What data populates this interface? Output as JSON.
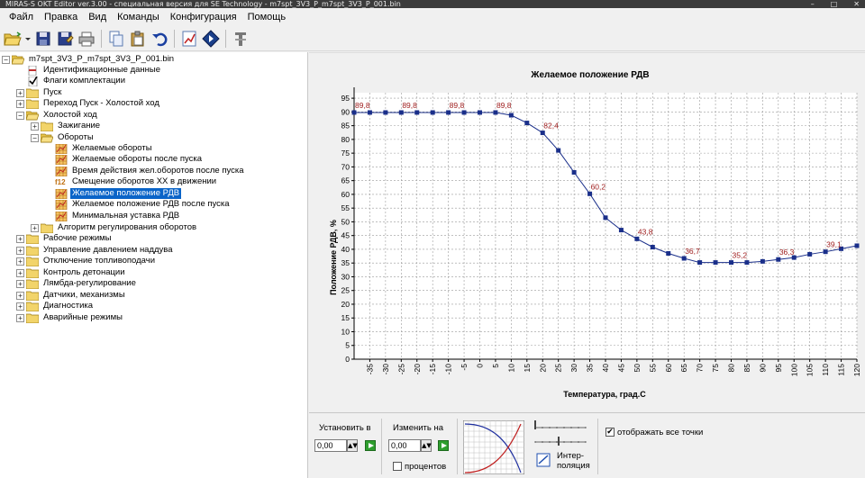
{
  "window": {
    "title": "MIRAS-S OKT Editor ver.3.00 - специальная версия для SE Technology - m7spt_3V3_P_m7spt_3V3_P_001.bin",
    "minimize_glyph": "–",
    "maximize_glyph": "□",
    "close_glyph": "✕"
  },
  "menu": {
    "items": [
      "Файл",
      "Правка",
      "Вид",
      "Команды",
      "Конфигурация",
      "Помощь"
    ]
  },
  "toolbar": {
    "icons": [
      "open-folder-icon",
      "save-icon",
      "save-as-icon",
      "print-icon",
      "copy-icon",
      "paste-icon",
      "undo-icon",
      "chart-icon",
      "diamond-nav-icon",
      "tools-icon"
    ]
  },
  "tree": {
    "root": "m7spt_3V3_P_m7spt_3V3_P_001.bin",
    "n_ident": "Идентификационные данные",
    "n_flags": "Флаги комплектации",
    "n_pusk": "Пуск",
    "n_perehod": "Переход Пуск - Холостой ход",
    "n_hh": "Холостой ход",
    "n_zazh": "Зажигание",
    "n_obor": "Обороты",
    "n_o1": "Желаемые обороты",
    "n_o2": "Желаемые обороты после пуска",
    "n_o3": "Время действия жел.оборотов после пуска",
    "n_o4": "Смещение оборотов ХХ в движении",
    "n_o4_badge": "f12",
    "n_o5": "Желаемое положение РДВ",
    "n_o6": "Желаемое положение РДВ после пуска",
    "n_o7": "Минимальная уставка РДВ",
    "n_alg": "Алгоритм регулирования оборотов",
    "n_rab": "Рабочие режимы",
    "n_upr": "Управление давлением наддува",
    "n_otkl": "Отключение топливоподачи",
    "n_kontr": "Контроль детонации",
    "n_lyam": "Лямбда-регулирование",
    "n_dat": "Датчики, механизмы",
    "n_diag": "Диагностика",
    "n_avar": "Аварийные режимы",
    "expand_glyph": "+",
    "collapse_glyph": "−",
    "checkmark": "✔"
  },
  "chart_data": {
    "type": "line",
    "title": "Желаемое положение РДВ",
    "xlabel": "Температура, град.С",
    "ylabel": "Положение РДВ, %",
    "x": [
      -40,
      -35,
      -30,
      -25,
      -20,
      -15,
      -10,
      -5,
      0,
      5,
      10,
      15,
      20,
      25,
      30,
      35,
      40,
      45,
      50,
      55,
      60,
      65,
      70,
      75,
      80,
      85,
      90,
      95,
      100,
      105,
      110,
      115,
      120
    ],
    "series": [
      {
        "values": [
          89.8,
          89.8,
          89.8,
          89.8,
          89.8,
          89.8,
          89.8,
          89.8,
          89.8,
          89.8,
          88.8,
          86.0,
          82.4,
          76.0,
          68.0,
          60.2,
          51.5,
          47.0,
          43.8,
          40.8,
          38.5,
          36.7,
          35.2,
          35.2,
          35.2,
          35.2,
          35.6,
          36.3,
          37.0,
          38.2,
          39.1,
          40.2,
          41.3
        ],
        "color": "#1a2f8a"
      }
    ],
    "point_labels": [
      {
        "x": -40,
        "y": 89.8,
        "text": "89,8"
      },
      {
        "x": -25,
        "y": 89.8,
        "text": "89,8"
      },
      {
        "x": -10,
        "y": 89.8,
        "text": "89,8"
      },
      {
        "x": 5,
        "y": 89.8,
        "text": "89,8"
      },
      {
        "x": 20,
        "y": 82.4,
        "text": "82,4"
      },
      {
        "x": 35,
        "y": 60.2,
        "text": "60,2"
      },
      {
        "x": 50,
        "y": 43.8,
        "text": "43,8"
      },
      {
        "x": 65,
        "y": 36.7,
        "text": "36,7"
      },
      {
        "x": 80,
        "y": 35.2,
        "text": "35,2"
      },
      {
        "x": 95,
        "y": 36.3,
        "text": "36,3"
      },
      {
        "x": 110,
        "y": 39.1,
        "text": "39,1"
      }
    ],
    "xticks": [
      -35,
      -30,
      -25,
      -20,
      -15,
      -10,
      -5,
      0,
      5,
      10,
      15,
      20,
      25,
      30,
      35,
      40,
      45,
      50,
      55,
      60,
      65,
      70,
      75,
      80,
      85,
      90,
      95,
      100,
      105,
      110,
      115,
      120
    ],
    "yticks": [
      0,
      5,
      10,
      15,
      20,
      25,
      30,
      35,
      40,
      45,
      50,
      55,
      60,
      65,
      70,
      75,
      80,
      85,
      90,
      95
    ],
    "xlim": [
      -40,
      120
    ],
    "ylim": [
      0,
      97
    ],
    "grid": true,
    "label_color": "#a02020"
  },
  "controls": {
    "set_label": "Установить в",
    "set_value": "0,00",
    "change_label": "Изменить на",
    "change_value": "0,00",
    "percent_label": "процентов",
    "show_points_label": "отображать все точки",
    "interp_label_line1": "Интер-",
    "interp_label_line2": "поляция",
    "spin_glyph": "▲▼",
    "check_glyph": "✔"
  }
}
